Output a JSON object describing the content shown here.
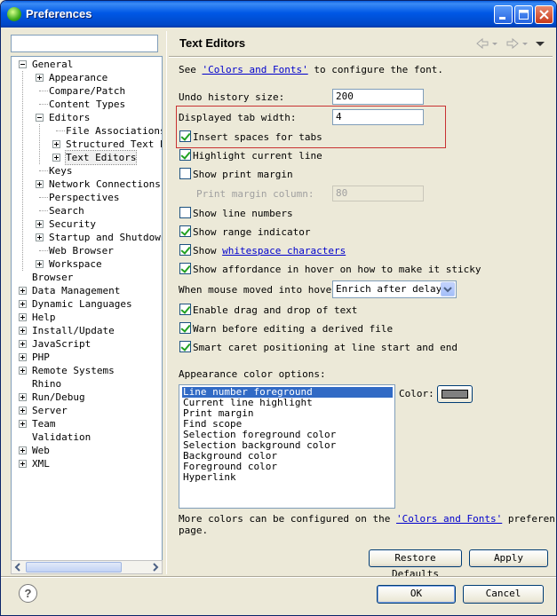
{
  "window": {
    "title": "Preferences"
  },
  "filter": {
    "value": "",
    "placeholder": ""
  },
  "tree": {
    "items": [
      {
        "label": "General",
        "level": 0,
        "toggle": "minus"
      },
      {
        "label": "Appearance",
        "level": 1,
        "toggle": "plus"
      },
      {
        "label": "Compare/Patch",
        "level": 1,
        "toggle": "none"
      },
      {
        "label": "Content Types",
        "level": 1,
        "toggle": "none"
      },
      {
        "label": "Editors",
        "level": 1,
        "toggle": "minus"
      },
      {
        "label": "File Associations",
        "level": 2,
        "toggle": "none"
      },
      {
        "label": "Structured Text Editors",
        "level": 2,
        "toggle": "plus"
      },
      {
        "label": "Text Editors",
        "level": 2,
        "toggle": "plus",
        "selected": true
      },
      {
        "label": "Keys",
        "level": 1,
        "toggle": "none"
      },
      {
        "label": "Network Connections",
        "level": 1,
        "toggle": "plus"
      },
      {
        "label": "Perspectives",
        "level": 1,
        "toggle": "none"
      },
      {
        "label": "Search",
        "level": 1,
        "toggle": "none"
      },
      {
        "label": "Security",
        "level": 1,
        "toggle": "plus"
      },
      {
        "label": "Startup and Shutdown",
        "level": 1,
        "toggle": "plus"
      },
      {
        "label": "Web Browser",
        "level": 1,
        "toggle": "none"
      },
      {
        "label": "Workspace",
        "level": 1,
        "toggle": "plus"
      },
      {
        "label": "Browser",
        "level": 0,
        "toggle": "none"
      },
      {
        "label": "Data Management",
        "level": 0,
        "toggle": "plus"
      },
      {
        "label": "Dynamic Languages",
        "level": 0,
        "toggle": "plus"
      },
      {
        "label": "Help",
        "level": 0,
        "toggle": "plus"
      },
      {
        "label": "Install/Update",
        "level": 0,
        "toggle": "plus"
      },
      {
        "label": "JavaScript",
        "level": 0,
        "toggle": "plus"
      },
      {
        "label": "PHP",
        "level": 0,
        "toggle": "plus"
      },
      {
        "label": "Remote Systems",
        "level": 0,
        "toggle": "plus"
      },
      {
        "label": "Rhino",
        "level": 0,
        "toggle": "none"
      },
      {
        "label": "Run/Debug",
        "level": 0,
        "toggle": "plus"
      },
      {
        "label": "Server",
        "level": 0,
        "toggle": "plus"
      },
      {
        "label": "Team",
        "level": 0,
        "toggle": "plus"
      },
      {
        "label": "Validation",
        "level": 0,
        "toggle": "none"
      },
      {
        "label": "Web",
        "level": 0,
        "toggle": "plus"
      },
      {
        "label": "XML",
        "level": 0,
        "toggle": "plus"
      }
    ]
  },
  "page": {
    "title": "Text Editors",
    "see_prefix": "See ",
    "colors_fonts_link": "'Colors and Fonts'",
    "see_suffix": " to configure the font.",
    "undo_label": "Undo history size:",
    "undo_value": "200",
    "tab_width_label": "Displayed tab width:",
    "tab_width_value": "4",
    "insert_spaces_label": "Insert spaces for tabs",
    "insert_spaces_checked": true,
    "highlight_line_label": "Highlight current line",
    "highlight_line_checked": true,
    "print_margin_label": "Show print margin",
    "print_margin_checked": false,
    "print_margin_column_label": "Print margin column:",
    "print_margin_column_value": "80",
    "line_numbers_label": "Show line numbers",
    "line_numbers_checked": false,
    "range_indicator_label": "Show range indicator",
    "range_indicator_checked": true,
    "whitespace_prefix": "Show ",
    "whitespace_link": "whitespace characters",
    "whitespace_checked": true,
    "affordance_label": "Show affordance in hover on how to make it sticky",
    "affordance_checked": true,
    "hover_label": "When mouse moved into hover:",
    "hover_value": "Enrich after delay",
    "drag_drop_label": "Enable drag and drop of text",
    "drag_drop_checked": true,
    "warn_derived_label": "Warn before editing a derived file",
    "warn_derived_checked": true,
    "smart_caret_label": "Smart caret positioning at line start and end",
    "smart_caret_checked": true,
    "appearance_color_label": "Appearance color options:",
    "color_options": [
      "Line number foreground",
      "Current line highlight",
      "Print margin",
      "Find scope",
      "Selection foreground color",
      "Selection background color",
      "Background color",
      "Foreground color",
      "Hyperlink"
    ],
    "selected_color_option": 0,
    "color_label": "Color:",
    "color_value": "#808080",
    "more_colors_prefix": "More colors can be configured on the ",
    "more_colors_link": "'Colors and Fonts'",
    "more_colors_suffix": " preference",
    "more_colors_line2": "page.",
    "restore_defaults": "Restore Defaults",
    "apply": "Apply"
  },
  "footer": {
    "ok": "OK",
    "cancel": "Cancel",
    "help": "?"
  },
  "colors": {
    "titlebar": "#0058e6",
    "highlight_box": "#c83232",
    "selection": "#316ac5",
    "window_bg": "#ece9d8"
  }
}
